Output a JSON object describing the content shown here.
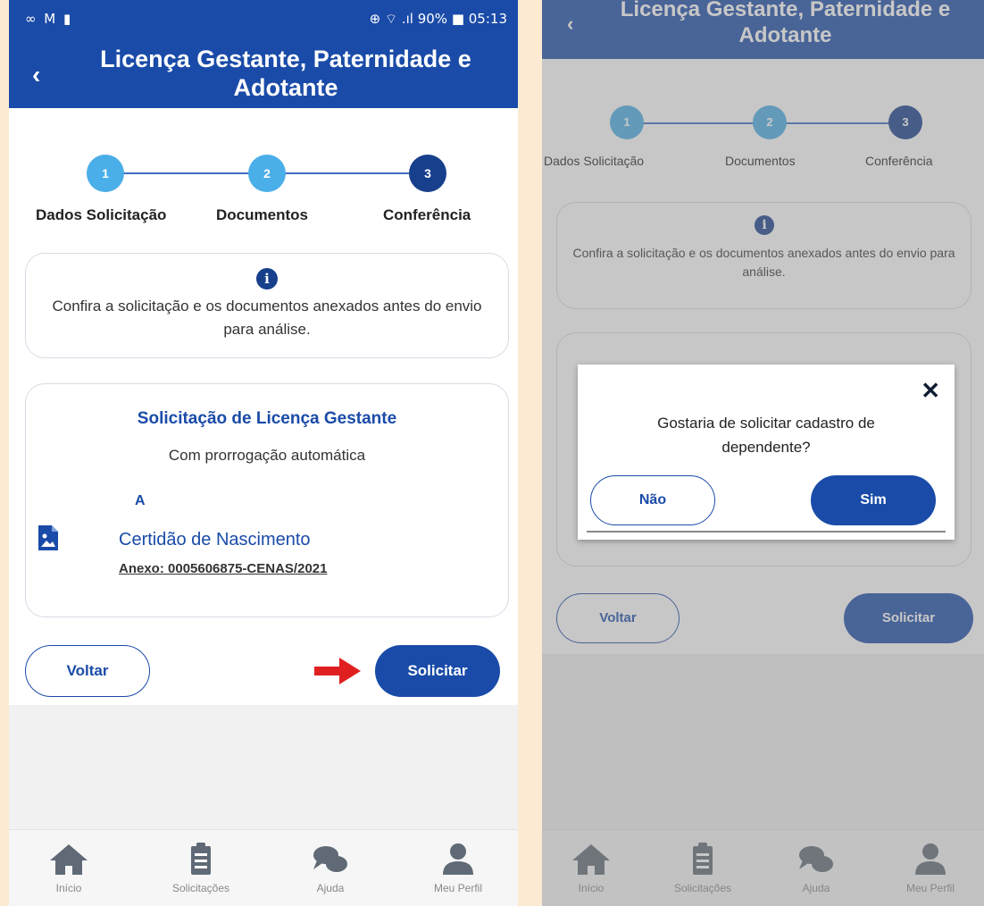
{
  "colors": {
    "primary": "#1a4ba8",
    "step_done": "#4aaee8",
    "step_active": "#173f8c",
    "arrow": "#e02020",
    "background": "#fcebd2"
  },
  "left": {
    "status": {
      "icons": "∞ M ▮",
      "right": "⊕ ⌔ .ıl 90% ■ 05:13"
    },
    "header": {
      "back_icon": "‹",
      "title": "Licença Gestante, Paternidade e Adotante"
    },
    "steps": [
      {
        "number": "1",
        "label": "Dados Solicitação"
      },
      {
        "number": "2",
        "label": "Documentos"
      },
      {
        "number": "3",
        "label": "Conferência"
      }
    ],
    "info": {
      "icon": "i",
      "text": "Confira a solicitação e os documentos anexados antes do envio para análise."
    },
    "request": {
      "title": "Solicitação de Licença Gestante",
      "subtitle": "Com prorrogação automática",
      "letter": "A",
      "doc_name": "Certidão de Nascimento",
      "attachment": "Anexo: 0005606875-CENAS/2021"
    },
    "buttons": {
      "back": "Voltar",
      "submit": "Solicitar"
    },
    "nav": [
      {
        "icon": "home-icon",
        "label": "Início"
      },
      {
        "icon": "clipboard-icon",
        "label": "Solicitações"
      },
      {
        "icon": "chat-icon",
        "label": "Ajuda"
      },
      {
        "icon": "user-icon",
        "label": "Meu Perfil"
      }
    ]
  },
  "right": {
    "header": {
      "back_icon": "‹",
      "title": "Licença Gestante, Paternidade e Adotante"
    },
    "steps": [
      {
        "number": "1",
        "label": "Dados Solicitação"
      },
      {
        "number": "2",
        "label": "Documentos"
      },
      {
        "number": "3",
        "label": "Conferência"
      }
    ],
    "info": {
      "icon": "i",
      "text": "Confira a solicitação e os documentos anexados antes do envio para análise."
    },
    "buttons": {
      "back": "Voltar",
      "submit": "Solicitar"
    },
    "dialog": {
      "close_icon": "✕",
      "question": "Gostaria de solicitar cadastro de dependente?",
      "no": "Não",
      "yes": "Sim"
    },
    "nav": [
      {
        "icon": "home-icon",
        "label": "Início"
      },
      {
        "icon": "clipboard-icon",
        "label": "Solicitações"
      },
      {
        "icon": "chat-icon",
        "label": "Ajuda"
      },
      {
        "icon": "user-icon",
        "label": "Meu Perfil"
      }
    ]
  }
}
